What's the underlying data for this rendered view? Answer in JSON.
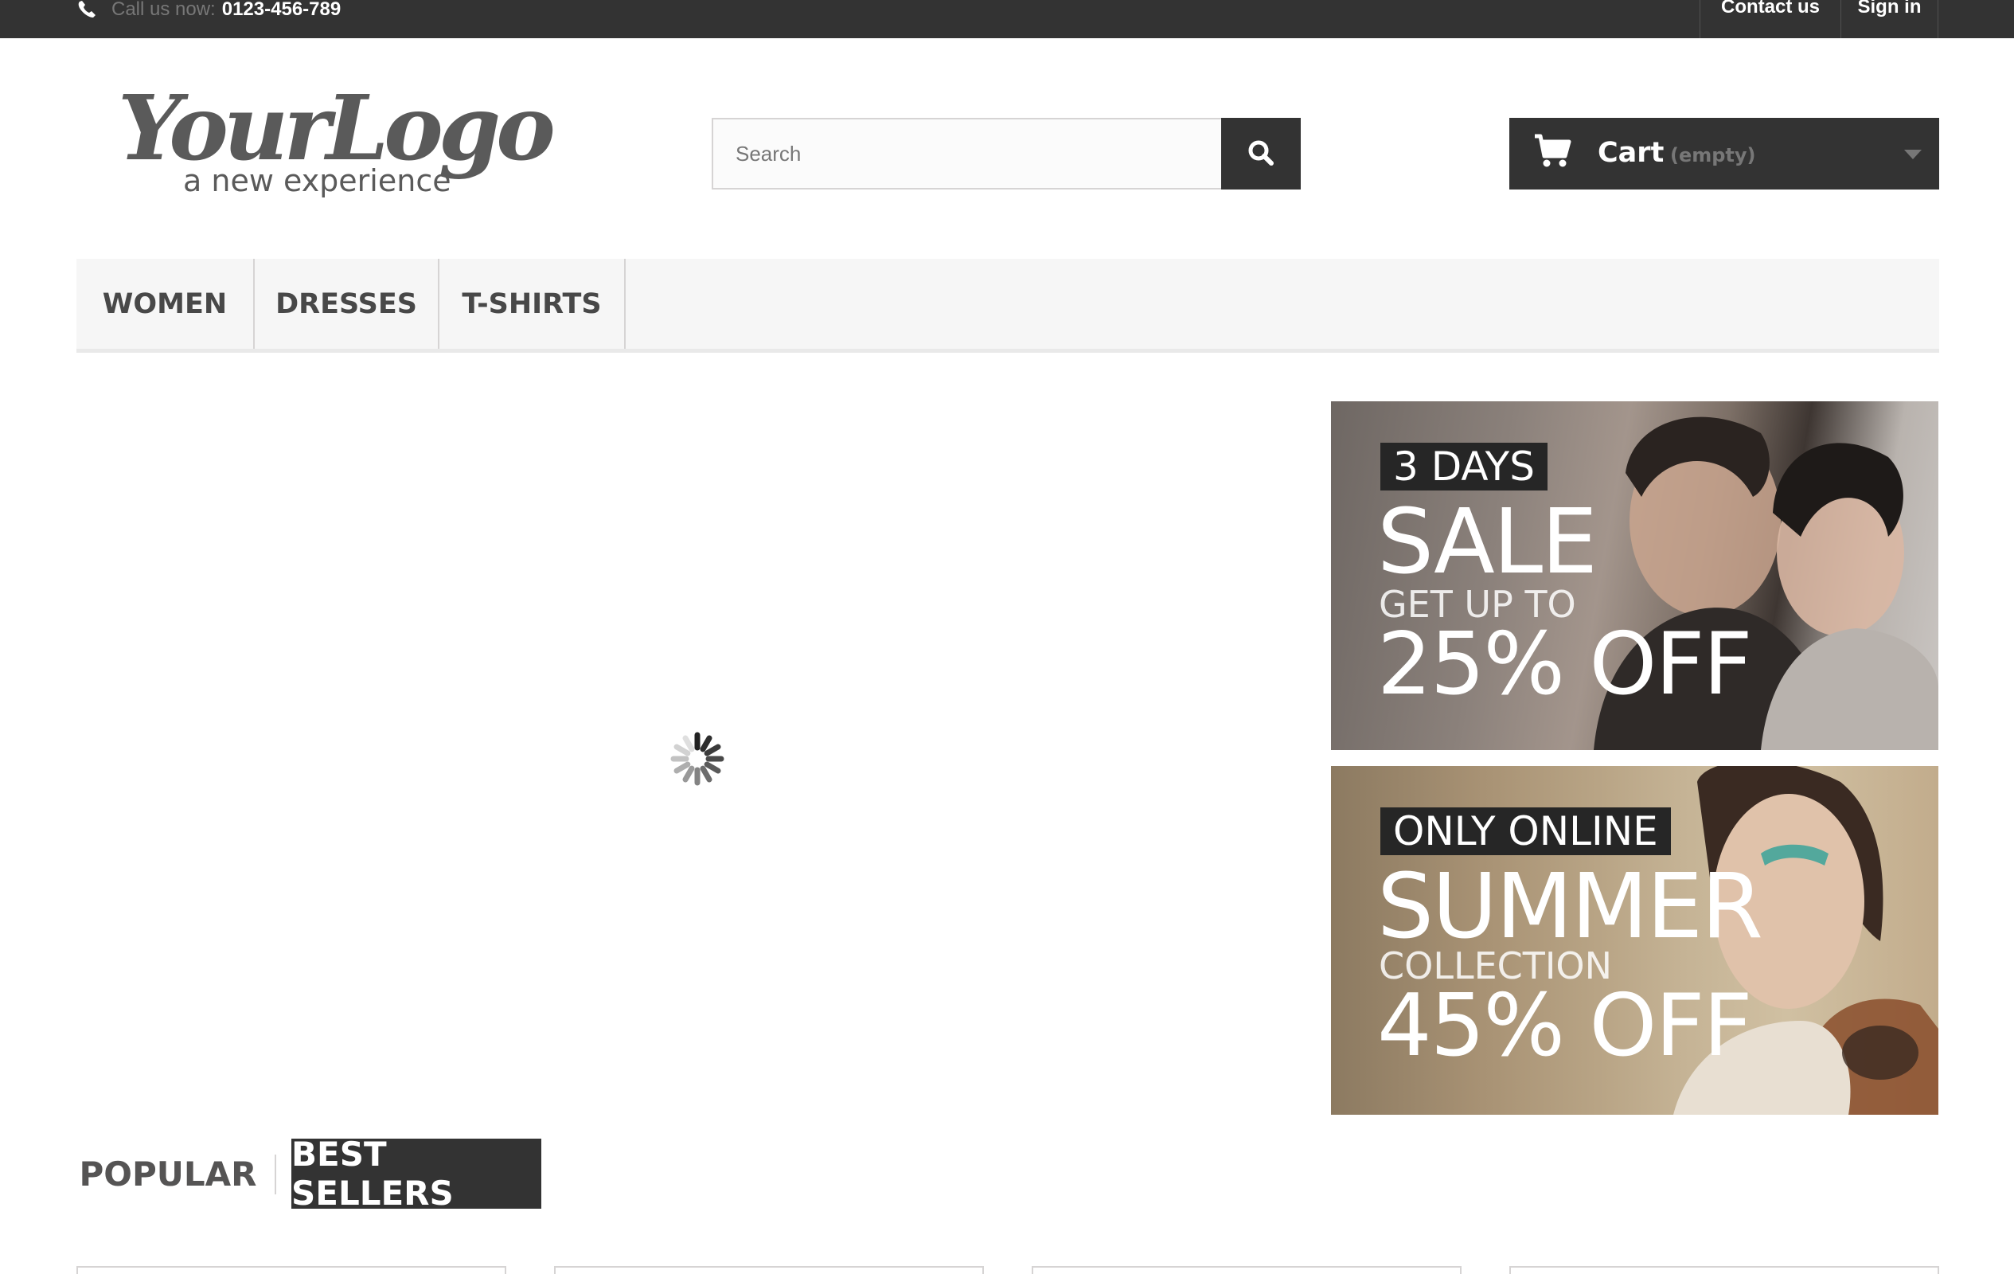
{
  "topbar": {
    "call_label": "Call us now:",
    "phone": "0123-456-789",
    "contact": "Contact us",
    "signin": "Sign in"
  },
  "logo": {
    "main": "YourLogo",
    "tagline": "a new experience"
  },
  "search": {
    "placeholder": "Search",
    "value": ""
  },
  "cart": {
    "label": "Cart",
    "status": "(empty)"
  },
  "nav": {
    "items": [
      {
        "label": "WOMEN"
      },
      {
        "label": "DRESSES"
      },
      {
        "label": "T-SHIRTS"
      }
    ]
  },
  "banners": [
    {
      "tag": "3 DAYS",
      "headline": "SALE",
      "subline": "GET UP TO",
      "offer": "25% OFF"
    },
    {
      "tag": "ONLY ONLINE",
      "headline": "SUMMER",
      "subline": "COLLECTION",
      "offer": "45% OFF"
    }
  ],
  "tabs": [
    {
      "label": "POPULAR",
      "active": false
    },
    {
      "label": "BEST SELLERS",
      "active": true
    }
  ],
  "colors": {
    "dark": "#333333",
    "nav_bg": "#f6f6f6",
    "border": "#d6d4d4",
    "muted": "#777777"
  },
  "icons": [
    "phone-icon",
    "search-icon",
    "cart-icon",
    "chevron-down-icon",
    "loading-spinner-icon"
  ]
}
